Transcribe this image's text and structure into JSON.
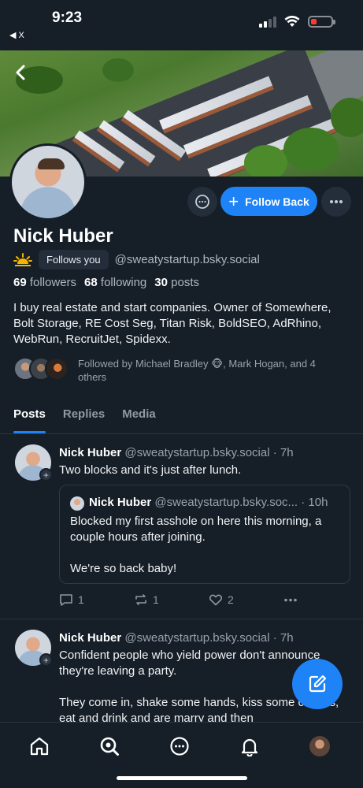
{
  "status_bar": {
    "time": "9:23",
    "back_label": "◀ X"
  },
  "profile": {
    "name": "Nick Huber",
    "follows_you": "Follows you",
    "handle": "@sweatystartup.bsky.social",
    "followers_count": "69",
    "followers_label": "followers",
    "following_count": "68",
    "following_label": "following",
    "posts_count": "30",
    "posts_label": "posts",
    "bio": "I buy real estate and start companies. Owner of Somewhere, Bolt Storage, RE Cost Seg, Titan Risk, BoldSEO, AdRhino, WebRun, RecruitJet, Spidexx.",
    "followed_by": "Followed by Michael Bradley 🐵, Mark Hogan, and 4 others",
    "follow_button": "Follow Back"
  },
  "tabs": [
    {
      "label": "Posts",
      "active": true
    },
    {
      "label": "Replies",
      "active": false
    },
    {
      "label": "Media",
      "active": false
    }
  ],
  "posts": [
    {
      "author": "Nick Huber",
      "handle": "@sweatystartup.bsky.social",
      "time": "· 7h",
      "text": "Two blocks and it's just after lunch.",
      "quote": {
        "author": "Nick Huber",
        "handle": "@sweatystartup.bsky.soc...",
        "time": "· 10h",
        "text": "Blocked my first asshole on here this morning, a couple hours after joining.\n\nWe're so back baby!"
      },
      "replies": "1",
      "reposts": "1",
      "likes": "2"
    },
    {
      "author": "Nick Huber",
      "handle": "@sweatystartup.bsky.social",
      "time": "· 7h",
      "text": "Confident people who yield power don't announce they're leaving a party.\n\nThey come in, shake some hands, kiss some cheeks, eat and drink and are marry and then"
    }
  ],
  "colors": {
    "accent": "#1e83f7",
    "background": "#161e27"
  }
}
